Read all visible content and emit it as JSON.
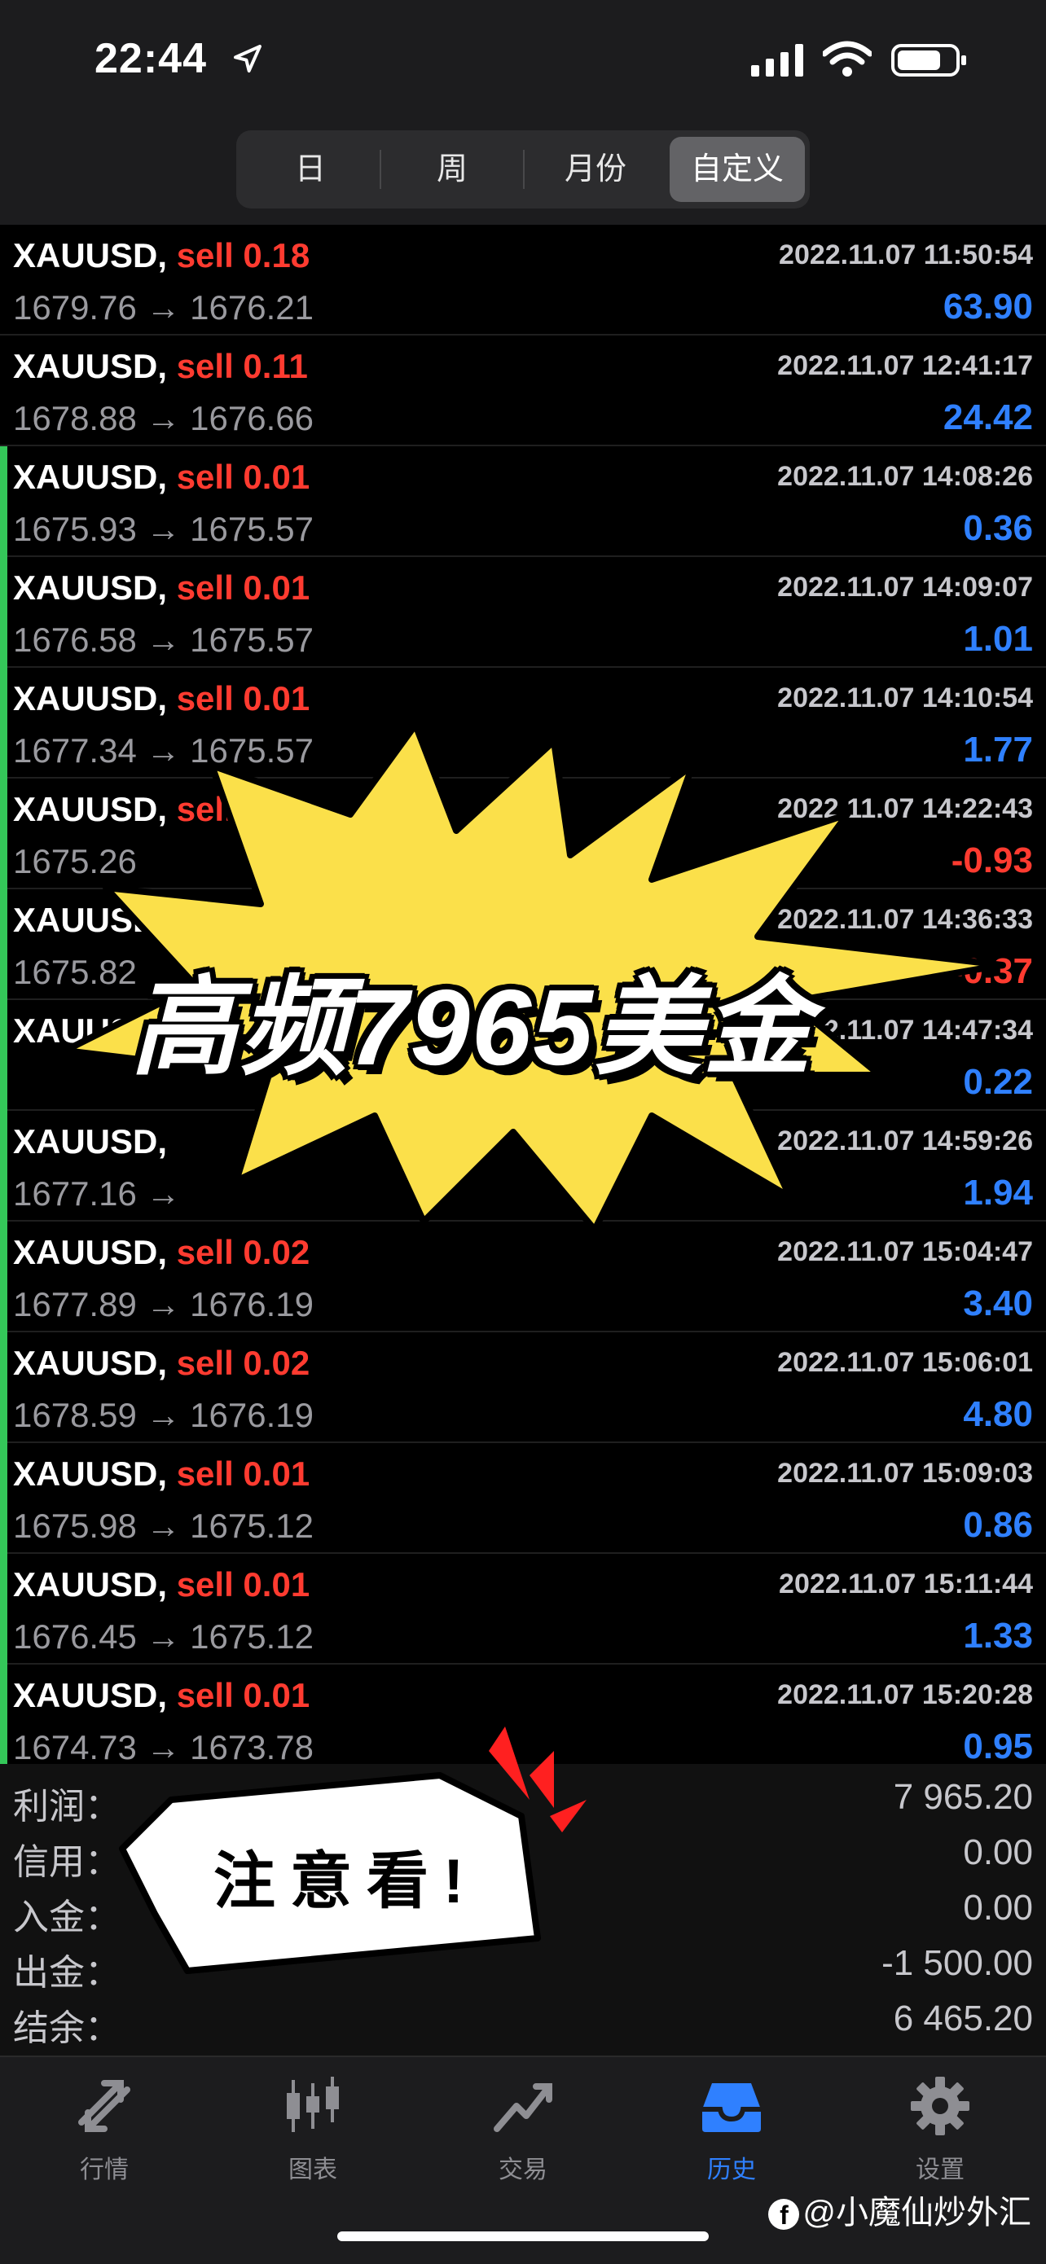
{
  "status_bar": {
    "time": "22:44"
  },
  "period_tabs": [
    {
      "label": "日",
      "active": false
    },
    {
      "label": "周",
      "active": false
    },
    {
      "label": "月份",
      "active": false
    },
    {
      "label": "自定义",
      "active": true
    }
  ],
  "trades": [
    {
      "symbol": "XAUUSD,",
      "side": "sell 0.18",
      "time": "2022.11.07 11:50:54",
      "prices": "1679.76 → 1676.21",
      "profit": "63.90"
    },
    {
      "symbol": "XAUUSD,",
      "side": "sell 0.11",
      "time": "2022.11.07 12:41:17",
      "prices": "1678.88 → 1676.66",
      "profit": "24.42"
    },
    {
      "symbol": "XAUUSD,",
      "side": "sell 0.01",
      "time": "2022.11.07 14:08:26",
      "prices": "1675.93 → 1675.57",
      "profit": "0.36"
    },
    {
      "symbol": "XAUUSD,",
      "side": "sell 0.01",
      "time": "2022.11.07 14:09:07",
      "prices": "1676.58 → 1675.57",
      "profit": "1.01"
    },
    {
      "symbol": "XAUUSD,",
      "side": "sell 0.01",
      "time": "2022.11.07 14:10:54",
      "prices": "1677.34 → 1675.57",
      "profit": "1.77"
    },
    {
      "symbol": "XAUUSD,",
      "side": "sell 0.01",
      "time": "2022.11.07 14:22:43",
      "prices": "1675.26",
      "profit": "-0.93"
    },
    {
      "symbol": "XAUUSD,",
      "side": "",
      "time": "2022.11.07 14:36:33",
      "prices": "1675.82",
      "profit": "-0.37"
    },
    {
      "symbol": "XAUUSD,",
      "side": "",
      "time": "2022.11.07 14:47:34",
      "prices": "",
      "profit": "0.22"
    },
    {
      "symbol": "XAUUSD,",
      "side": "",
      "time": "2022.11.07 14:59:26",
      "prices": "1677.16 →",
      "profit": "1.94"
    },
    {
      "symbol": "XAUUSD,",
      "side": "sell 0.02",
      "time": "2022.11.07 15:04:47",
      "prices": "1677.89 → 1676.19",
      "profit": "3.40"
    },
    {
      "symbol": "XAUUSD,",
      "side": "sell 0.02",
      "time": "2022.11.07 15:06:01",
      "prices": "1678.59 → 1676.19",
      "profit": "4.80"
    },
    {
      "symbol": "XAUUSD,",
      "side": "sell 0.01",
      "time": "2022.11.07 15:09:03",
      "prices": "1675.98 → 1675.12",
      "profit": "0.86"
    },
    {
      "symbol": "XAUUSD,",
      "side": "sell 0.01",
      "time": "2022.11.07 15:11:44",
      "prices": "1676.45 → 1675.12",
      "profit": "1.33"
    },
    {
      "symbol": "XAUUSD,",
      "side": "sell 0.01",
      "time": "2022.11.07 15:20:28",
      "prices": "1674.73 → 1673.78",
      "profit": "0.95"
    }
  ],
  "summary": [
    {
      "label": "利润：",
      "value": "7 965.20"
    },
    {
      "label": "信用：",
      "value": "0.00"
    },
    {
      "label": "入金：",
      "value": "0.00"
    },
    {
      "label": "出金：",
      "value": "-1 500.00"
    },
    {
      "label": "结余：",
      "value": "6 465.20"
    }
  ],
  "tab_bar": [
    {
      "label": "行情",
      "icon": "quotes-arrows-icon",
      "active": false
    },
    {
      "label": "图表",
      "icon": "candlestick-icon",
      "active": false
    },
    {
      "label": "交易",
      "icon": "trade-line-icon",
      "active": false
    },
    {
      "label": "历史",
      "icon": "history-inbox-icon",
      "active": true
    },
    {
      "label": "设置",
      "icon": "gear-icon",
      "active": false
    }
  ],
  "overlay": {
    "burst_text": "高频7965美金",
    "bubble_text": "注意看!"
  },
  "watermark": "@小魔仙炒外汇",
  "colors": {
    "sell": "#ff3b30",
    "profit_pos": "#2f80ff",
    "profit_neg": "#ff3b30",
    "accent_green": "#34c759",
    "burst_yellow": "#fbe04a"
  }
}
